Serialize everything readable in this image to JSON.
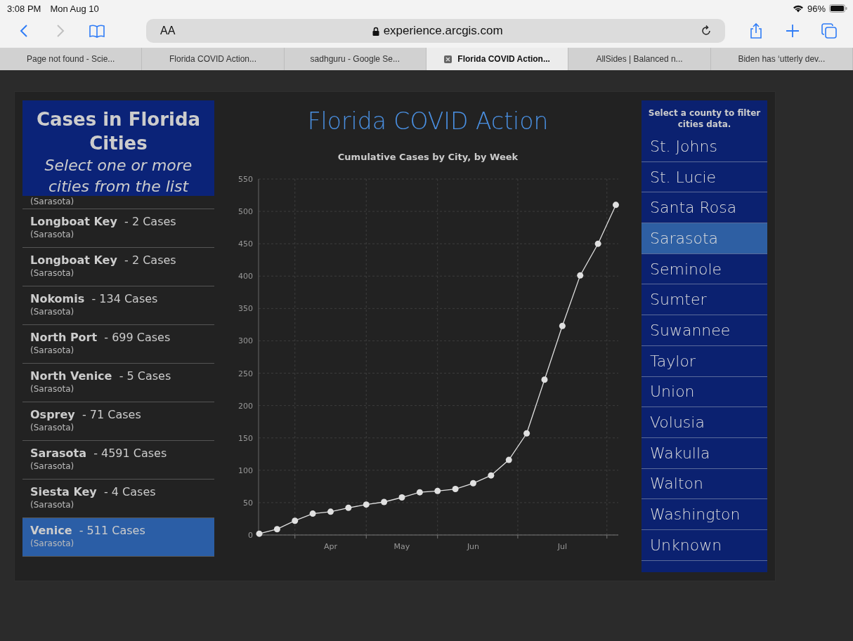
{
  "status_bar": {
    "time": "3:08 PM",
    "date": "Mon Aug 10",
    "battery": "96%"
  },
  "toolbar": {
    "back_disabled": false,
    "forward_disabled": true,
    "text_size": "AA",
    "url": "experience.arcgis.com"
  },
  "tabs": [
    {
      "label": "Page not found - Scie...",
      "selected": false
    },
    {
      "label": "Florida COVID Action...",
      "selected": false
    },
    {
      "label": "sadhguru - Google Se...",
      "selected": false
    },
    {
      "label": "Florida COVID Action...",
      "selected": true
    },
    {
      "label": "AllSides | Balanced n...",
      "selected": false
    },
    {
      "label": "Biden has ‘utterly dev...",
      "selected": false
    }
  ],
  "cities_panel": {
    "title": "Cases in Florida Cities",
    "subtitle": "Select one or more cities from the list",
    "cut_row_county": "(Sarasota)",
    "rows": [
      {
        "name": "Longboat Key",
        "cases": "- 2 Cases",
        "county": "(Sarasota)",
        "selected": false
      },
      {
        "name": "Longboat Key",
        "cases": "- 2 Cases",
        "county": "(Sarasota)",
        "selected": false
      },
      {
        "name": "Nokomis",
        "cases": "- 134 Cases",
        "county": "(Sarasota)",
        "selected": false
      },
      {
        "name": "North Port",
        "cases": "- 699 Cases",
        "county": "(Sarasota)",
        "selected": false
      },
      {
        "name": "North Venice",
        "cases": "- 5 Cases",
        "county": "(Sarasota)",
        "selected": false
      },
      {
        "name": "Osprey",
        "cases": "- 71 Cases",
        "county": "(Sarasota)",
        "selected": false
      },
      {
        "name": "Sarasota",
        "cases": "- 4591 Cases",
        "county": "(Sarasota)",
        "selected": false
      },
      {
        "name": "Siesta Key",
        "cases": "- 4 Cases",
        "county": "(Sarasota)",
        "selected": false
      },
      {
        "name": "Venice",
        "cases": "- 511 Cases",
        "county": "(Sarasota)",
        "selected": true
      }
    ]
  },
  "main": {
    "title": "Florida COVID Action",
    "chart_data": {
      "type": "line",
      "title": "Cumulative Cases by City, by Week",
      "categories": [
        null,
        null,
        null,
        null,
        "Apr",
        null,
        null,
        null,
        "May",
        null,
        null,
        null,
        "Jun",
        null,
        null,
        null,
        null,
        "Jul",
        null,
        null,
        null
      ],
      "grid": true,
      "series": [
        {
          "color": "#e0e0e0",
          "marker": true,
          "values": [
            2,
            9,
            22,
            33,
            36,
            42,
            47,
            51,
            58,
            66,
            68,
            71,
            80,
            92,
            116,
            157,
            240,
            323,
            401,
            450,
            510
          ]
        }
      ],
      "ylim": [
        0,
        550
      ],
      "yticks": [
        0,
        50,
        100,
        150,
        200,
        250,
        300,
        350,
        400,
        450,
        500,
        550
      ]
    }
  },
  "county_panel": {
    "heading": "Select a county to filter cities data.",
    "items": [
      {
        "label": "St. Johns",
        "selected": false
      },
      {
        "label": "St. Lucie",
        "selected": false
      },
      {
        "label": "Santa Rosa",
        "selected": false
      },
      {
        "label": "Sarasota",
        "selected": true
      },
      {
        "label": "Seminole",
        "selected": false
      },
      {
        "label": "Sumter",
        "selected": false
      },
      {
        "label": "Suwannee",
        "selected": false
      },
      {
        "label": "Taylor",
        "selected": false
      },
      {
        "label": "Union",
        "selected": false
      },
      {
        "label": "Volusia",
        "selected": false
      },
      {
        "label": "Wakulla",
        "selected": false
      },
      {
        "label": "Walton",
        "selected": false
      },
      {
        "label": "Washington",
        "selected": false
      },
      {
        "label": "Unknown",
        "selected": false
      }
    ]
  }
}
